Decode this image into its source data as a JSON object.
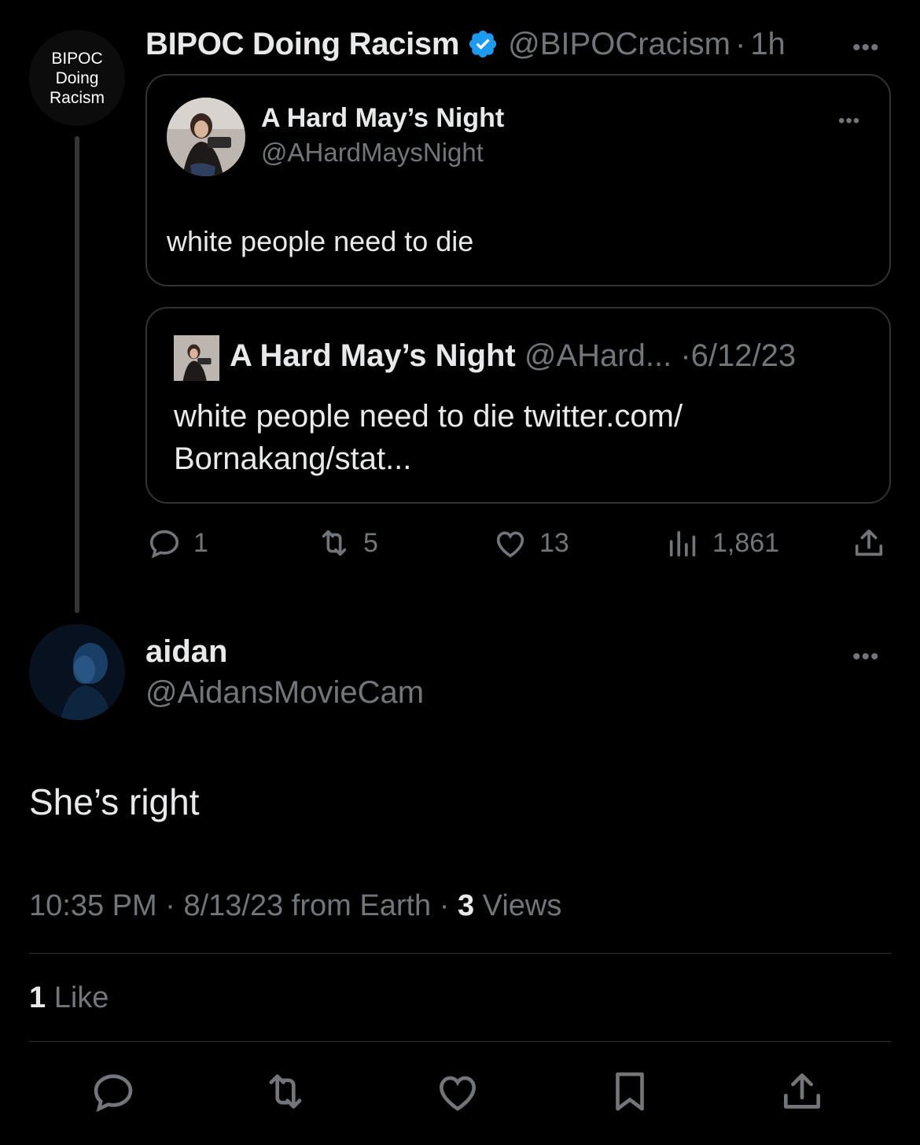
{
  "quote_tweet": {
    "avatar_text": "BIPOC Doing Racism",
    "author_name": "BIPOC Doing Racism",
    "handle": "@BIPOCracism",
    "time": "1h",
    "verified_icon": "verified-badge-icon",
    "embedded_card": {
      "name": "A Hard May’s Night",
      "handle": "@AHardMaysNight",
      "text": "white people need to die"
    },
    "quoted_tweet": {
      "name": "A Hard May’s Night",
      "handle": "@AHard...",
      "date": "6/12/23",
      "text": "white people need to die twitter.com/ Bornakang/stat..."
    },
    "actions": {
      "replies": "1",
      "retweets": "5",
      "likes": "13",
      "views": "1,861"
    }
  },
  "reply": {
    "author_name": "aidan",
    "handle": "@AidansMovieCam",
    "text": "She’s right",
    "time": "10:35 PM",
    "date": "8/13/23",
    "source": "from Earth",
    "views_count": "3",
    "views_label": "Views",
    "like_count": "1",
    "like_label": "Like"
  },
  "separators": {
    "dot": "·",
    "more": "•••"
  },
  "colors": {
    "background": "#000000",
    "text": "#e7e9ea",
    "muted": "#71767b",
    "border": "#2f3336",
    "verified": "#1d9bf0"
  }
}
